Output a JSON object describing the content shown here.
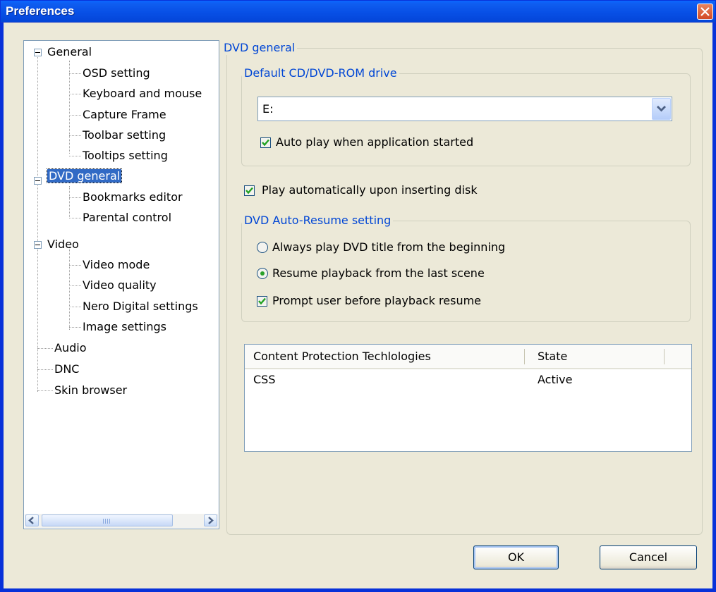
{
  "window": {
    "title": "Preferences"
  },
  "tree": {
    "items": [
      {
        "label": "General",
        "level": 0,
        "expandable": true
      },
      {
        "label": "OSD setting",
        "level": 1
      },
      {
        "label": "Keyboard and mouse",
        "level": 1
      },
      {
        "label": "Capture Frame",
        "level": 1
      },
      {
        "label": "Toolbar setting",
        "level": 1
      },
      {
        "label": "Tooltips setting",
        "level": 1
      },
      {
        "label": "DVD general",
        "level": 0,
        "expandable": true,
        "selected": true
      },
      {
        "label": "Bookmarks editor",
        "level": 1
      },
      {
        "label": "Parental control",
        "level": 1
      },
      {
        "label": "Video",
        "level": 0,
        "expandable": true
      },
      {
        "label": "Video mode",
        "level": 1
      },
      {
        "label": "Video quality",
        "level": 1
      },
      {
        "label": "Nero Digital settings",
        "level": 1
      },
      {
        "label": "Image settings",
        "level": 1
      },
      {
        "label": "Audio",
        "level": 0
      },
      {
        "label": "DNC",
        "level": 0
      },
      {
        "label": "Skin browser",
        "level": 0
      }
    ],
    "scrollbar_grip": "|||"
  },
  "dvd_general": {
    "group_title": "DVD general",
    "default_drive": {
      "group_title": "Default CD/DVD-ROM drive",
      "selected_drive": "E:",
      "auto_play_label": "Auto play when application started",
      "auto_play_checked": true
    },
    "play_on_insert_label": "Play automatically upon inserting disk",
    "play_on_insert_checked": true,
    "auto_resume": {
      "group_title": "DVD Auto-Resume setting",
      "option_beginning": "Always play DVD title from the beginning",
      "option_last_scene": "Resume playback from the last scene",
      "selected": "option_last_scene",
      "prompt_label": "Prompt user before playback resume",
      "prompt_checked": true
    },
    "protection_table": {
      "columns": [
        "Content Protection Techlologies",
        "State"
      ],
      "rows": [
        [
          "CSS",
          "Active"
        ]
      ]
    }
  },
  "buttons": {
    "ok": "OK",
    "cancel": "Cancel"
  },
  "colors": {
    "titlebar": "#0850e6",
    "accent_label": "#0046d5",
    "selection": "#316ac5",
    "check": "#2aa12a"
  }
}
